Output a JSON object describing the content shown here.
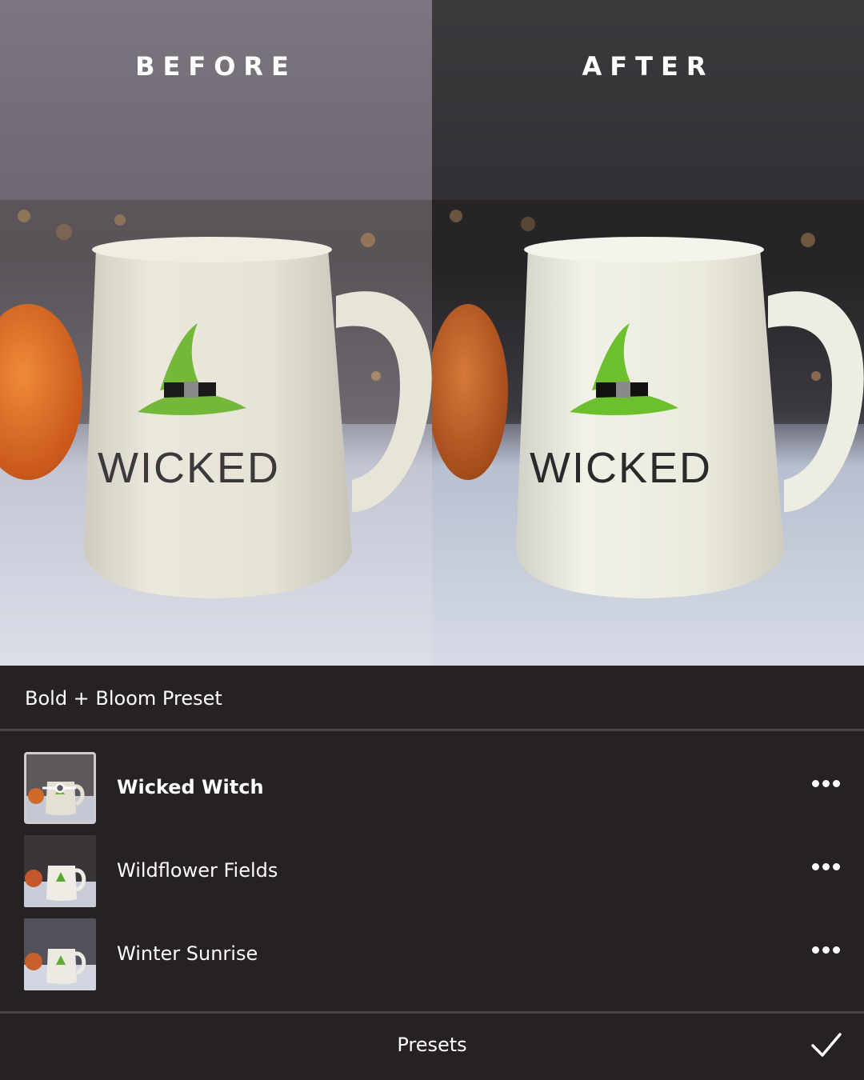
{
  "comparison": {
    "before_label": "BEFORE",
    "after_label": "AFTER",
    "mug_text": "WICKED"
  },
  "preset_group": {
    "title": "Bold + Bloom Preset"
  },
  "presets": [
    {
      "name": "Wicked Witch",
      "selected": true,
      "thumb_icon": "compare-slider-icon"
    },
    {
      "name": "Wildflower Fields",
      "selected": false
    },
    {
      "name": "Winter Sunrise",
      "selected": false
    }
  ],
  "bottom_bar": {
    "title": "Presets",
    "confirm_icon": "checkmark-icon"
  },
  "colors": {
    "panel_bg": "#262223",
    "divider": "#48454a",
    "text": "#ffffff"
  }
}
